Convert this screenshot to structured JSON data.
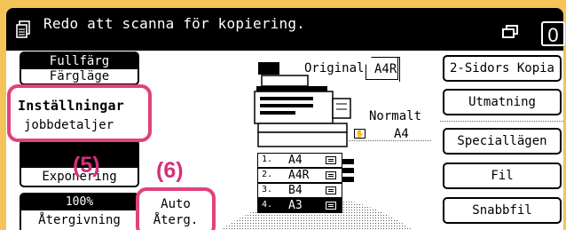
{
  "header": {
    "message": "Redo att scanna för kopiering.",
    "copy_count": "0"
  },
  "left": {
    "color_mode": {
      "value": "Fullfärg",
      "label": "Färgläge"
    },
    "job_settings": {
      "line1": "Inställningar",
      "line2": "jobbdetaljer"
    },
    "exposure": {
      "label": "Exponering"
    },
    "ratio": {
      "value": "100%",
      "label": "Återgivning"
    },
    "auto_ratio": {
      "line1": "Auto",
      "line2": "Återg."
    }
  },
  "callouts": {
    "c5": "(5)",
    "c6": "(6)"
  },
  "original": {
    "label": "Original",
    "size": "A4R"
  },
  "output_tray": {
    "label": "Normalt",
    "size": "A4"
  },
  "trays": [
    {
      "num": "1.",
      "size": "A4",
      "selected": false
    },
    {
      "num": "2.",
      "size": "A4R",
      "selected": false
    },
    {
      "num": "3.",
      "size": "B4",
      "selected": false
    },
    {
      "num": "4.",
      "size": "A3",
      "selected": true
    }
  ],
  "right_buttons": [
    "2-Sidors Kopia",
    "Utmatning",
    "Speciallägen",
    "Fil",
    "Snabbfil"
  ],
  "colors": {
    "frame": "#f4c45a",
    "callout": "#e0427e"
  }
}
